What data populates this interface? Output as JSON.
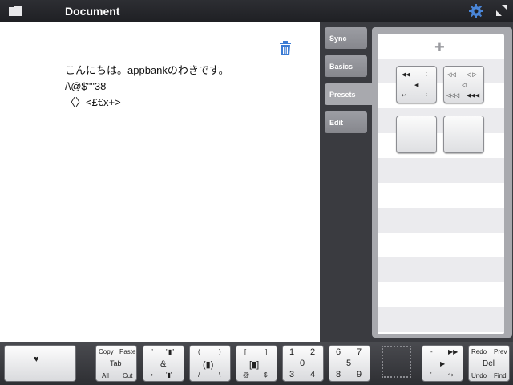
{
  "topbar": {
    "title": "Document"
  },
  "document": {
    "lines": [
      "こんにちは。appbankのわきです。",
      "/\\@$\"\"38",
      "〈〉<£€x+>"
    ]
  },
  "side_tabs": [
    "Sync",
    "Basics",
    "Presets",
    "Edit"
  ],
  "preset_keys": {
    "key1": {
      "tl": "◀◀",
      "tr": ";",
      "c": "◀",
      "bl": "↩",
      "br": ":"
    },
    "key2": {
      "tl": "◁◁",
      "tr": "◁ ▷",
      "c": "◁",
      "bl": "◁◁◁",
      "br": "◀◀◀"
    }
  },
  "keyboard": {
    "heart": "♥",
    "copy": "Copy",
    "paste": "Paste",
    "tab": "Tab",
    "all": "All",
    "cut": "Cut",
    "q_tl": "\"",
    "q_tr": "\"▮\"",
    "q_c": "&",
    "q_bl": "•",
    "q_br": "'▮'",
    "p_tl": "(",
    "p_tr": ")",
    "p_c": "(▮)",
    "p_bl": "/",
    "p_br": "\\",
    "b_tl": "[",
    "b_tr": "]",
    "b_c": "[▮]",
    "b_bl": "@",
    "b_br": "$",
    "n1_tl": "1",
    "n1_tr": "2",
    "n1_c": "0",
    "n1_bl": "3",
    "n1_br": "4",
    "n2_tl": "6",
    "n2_tr": "7",
    "n2_c": "5",
    "n2_bl": "8",
    "n2_br": "9",
    "m_tl": "-",
    "m_tr": "▶▶",
    "m_c": "▶",
    "m_bl": "'",
    "m_br": "↪",
    "redo": "Redo",
    "prev": "Prev",
    "del": "Del",
    "undo": "Undo",
    "find": "Find"
  },
  "colors": {
    "accent": "#3b7bd4",
    "gear": "#4a86d8",
    "trash": "#3b7bd4"
  }
}
